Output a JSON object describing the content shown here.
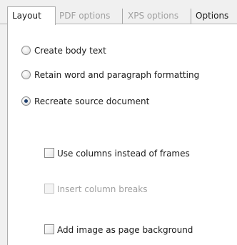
{
  "tabs": [
    {
      "label": "Layout",
      "active": true,
      "enabled": true
    },
    {
      "label": "PDF options",
      "active": false,
      "enabled": false
    },
    {
      "label": "XPS options",
      "active": false,
      "enabled": false
    },
    {
      "label": "Options",
      "active": false,
      "enabled": true
    }
  ],
  "layout": {
    "radios": [
      {
        "label": "Create body text",
        "checked": false
      },
      {
        "label": "Retain word and paragraph formatting",
        "checked": false
      },
      {
        "label": "Recreate source document",
        "checked": true
      }
    ],
    "checkboxes": [
      {
        "label": "Use columns instead of frames",
        "checked": false,
        "enabled": true
      },
      {
        "label": "Insert column breaks",
        "checked": false,
        "enabled": false
      },
      {
        "label": "Add image as page background",
        "checked": false,
        "enabled": true
      }
    ]
  },
  "colors": {
    "panel_background": "#ffffff",
    "window_background": "#f0f0f0",
    "disabled_text": "#a0a0a0",
    "radio_dot": "#1f3f6e"
  }
}
